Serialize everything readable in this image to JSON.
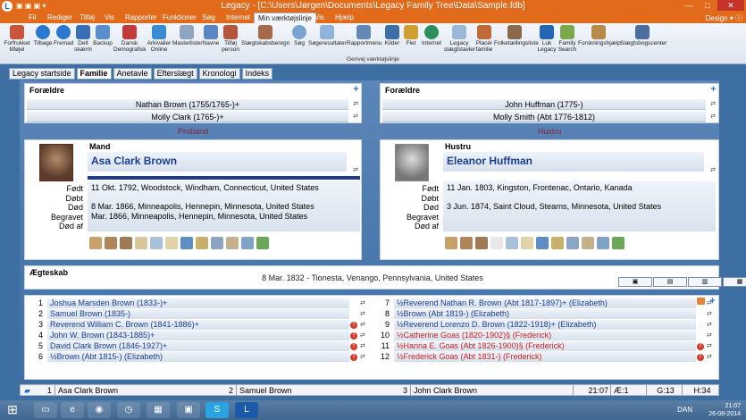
{
  "window": {
    "title": "Legacy - [C:\\Users\\Jørgen\\Documents\\Legacy Family Tree\\Data\\Sample.fdb]",
    "logo": "L",
    "controls": {
      "minimize": "—",
      "maximize": "□",
      "close": "✕"
    }
  },
  "menu": {
    "items": [
      "Fil",
      "Rediger",
      "Tilføj",
      "Vis",
      "Rapporter",
      "Funktioner",
      "Søg",
      "Internet",
      "Min værktøjslinje",
      "Vis",
      "Hjælp"
    ],
    "active_index": 8,
    "design": "Design"
  },
  "ribbon": {
    "buttons": [
      "Forfrukket tilføjel",
      "Tilbage",
      "Fremad",
      "Delt skærm",
      "Backup",
      "Dansk Demografisk",
      "Arkivalier Online",
      "Masterlister",
      "Navne",
      "Tilføj person",
      "Slægtskabsberegn",
      "Søg",
      "Søgeresultater",
      "Rapportmenu",
      "Kilder",
      "Flet",
      "Internet",
      "Legacy slægtstavler",
      "Placér familie",
      "Folketællingsliste",
      "Luk Legacy",
      "Family Search",
      "Forskningshjælp",
      "Slægtsbogscenter"
    ],
    "group_label": "Genvej værktøjslinje"
  },
  "tabs": [
    "Legacy startside",
    "Familie",
    "Anetavle",
    "Efterslægt",
    "Kronologi",
    "Indeks"
  ],
  "active_tab": 1,
  "parents_left": {
    "label": "Forældre",
    "father": "Nathan Brown (1755/1765-)+",
    "mother": "Molly Clark (1765-)+"
  },
  "parents_right": {
    "label": "Forældre",
    "father": "John Huffman (1775-)",
    "mother": "Molly Smith (Abt 1776-1812)"
  },
  "role_left": "Proband",
  "role_right": "Hustru",
  "husband": {
    "label": "Mand",
    "name": "Asa Clark Brown",
    "event_labels": [
      "Født",
      "Døbt",
      "Død",
      "Begravet",
      "Død af"
    ],
    "born": "11 Okt. 1792, Woodstock, Windham, Connecticut, United States",
    "died": "8 Mar. 1866, Minneapolis, Hennepin, Minnesota, United States",
    "buried": "Mar. 1866, Minneapolis, Hennepin, Minnesota, United States"
  },
  "wife": {
    "label": "Hustru",
    "name": "Eleanor Huffman",
    "event_labels": [
      "Født",
      "Døbt",
      "Død",
      "Begravet",
      "Død af"
    ],
    "born": "11 Jan. 1803, Kingston, Frontenac, Ontario, Kanada",
    "died": "3 Jun. 1874, Saint Cloud, Stearns, Minnesota, United States"
  },
  "marriage": {
    "label": "Ægteskab",
    "event": "8 Mar. 1832 - Tionesta, Venango, Pennsylvania, United States"
  },
  "children": [
    {
      "n": "1",
      "name": "Joshua Marsden Brown (1833-)+",
      "color": "blue",
      "warn": false
    },
    {
      "n": "2",
      "name": "Samuel Brown (1835-)",
      "color": "blue",
      "warn": false
    },
    {
      "n": "3",
      "name": "Reverend William C. Brown (1841-1886)+",
      "color": "blue",
      "warn": true
    },
    {
      "n": "4",
      "name": "John W. Brown (1843-1885)+",
      "color": "blue",
      "warn": true
    },
    {
      "n": "5",
      "name": "David Clark Brown (1846-1927)+",
      "color": "blue",
      "warn": true
    },
    {
      "n": "6",
      "name": "½Brown (Abt 1815-) (Elizabeth)",
      "color": "blue",
      "warn": true
    },
    {
      "n": "7",
      "name": "½Reverend Nathan R. Brown (Abt 1817-1897)+ (Elizabeth)",
      "color": "blue",
      "warn": false
    },
    {
      "n": "8",
      "name": "½Brown (Abt 1819-) (Elizabeth)",
      "color": "blue",
      "warn": false
    },
    {
      "n": "9",
      "name": "½Reverend Lorenzo D. Brown (1822-1918)+ (Elizabeth)",
      "color": "blue",
      "warn": false
    },
    {
      "n": "10",
      "name": "½Catherine Goas (1820-1902)§ (Frederick)",
      "color": "red",
      "warn": false
    },
    {
      "n": "11",
      "name": "½Hanna E. Goas (Abt 1826-1900)§ (Frederick)",
      "color": "red",
      "warn": true
    },
    {
      "n": "12",
      "name": "½Frederick Goas (Abt 1831-) (Frederick)",
      "color": "red",
      "warn": true
    }
  ],
  "statusbar": {
    "n1": "1",
    "name1": "Asa Clark Brown",
    "n2": "2",
    "name2": "Samuel Brown",
    "n3": "3",
    "name3": "John Clark Brown",
    "time": "21:07",
    "ae": "Æ:1",
    "g": "G:13",
    "h": "H:34"
  },
  "taskbar": {
    "lang": "DAN",
    "time": "21:07",
    "date": "26-08-2014"
  },
  "colors": {
    "accent": "#e26a1b",
    "background": "#3d6fa3",
    "name_blue": "#1c3d8f",
    "role_red": "#8a1f3a"
  }
}
